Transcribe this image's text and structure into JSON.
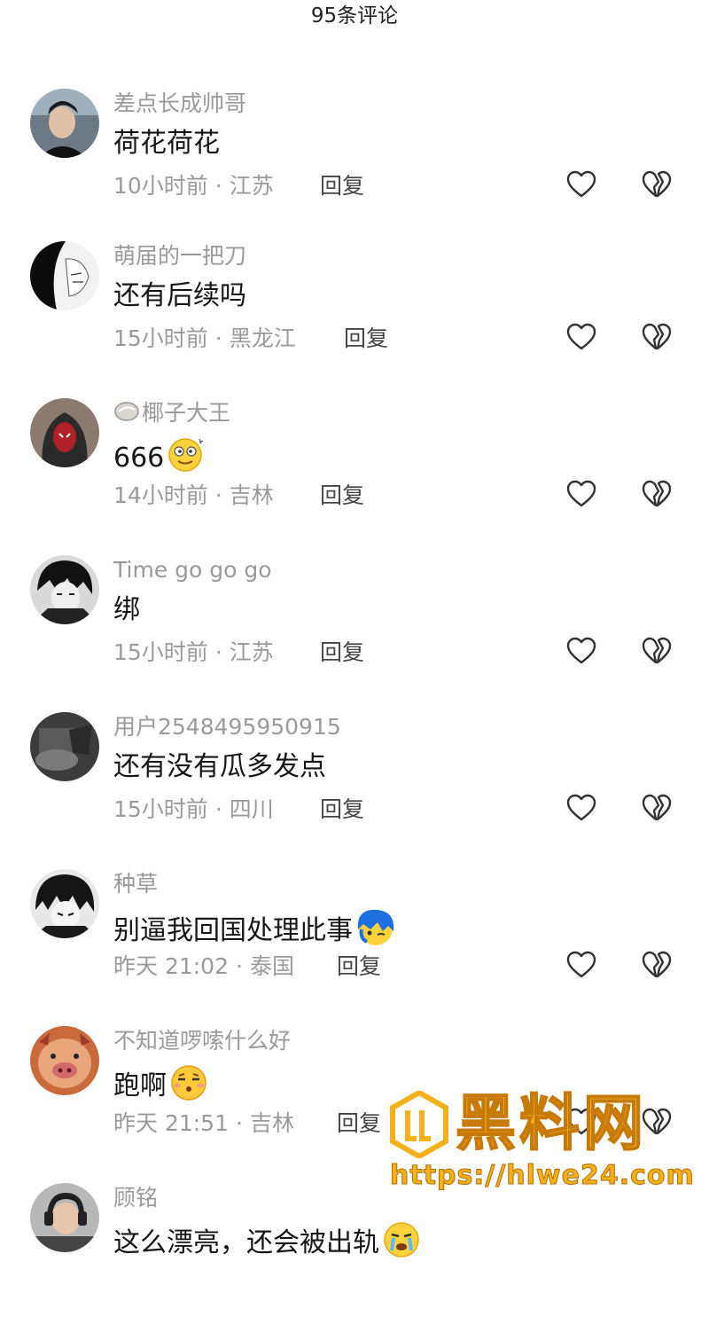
{
  "header": {
    "title": "95条评论"
  },
  "comments": [
    {
      "username": "差点长成帅哥",
      "text": "荷花荷花",
      "time": "10小时前",
      "location": "江苏",
      "reply": "回复",
      "avatar": "avatar-young-man"
    },
    {
      "username": "萌届的一把刀",
      "text": "还有后续吗",
      "time": "15小时前",
      "location": "黑龙江",
      "reply": "回复",
      "avatar": "avatar-anime-sketch"
    },
    {
      "username": "椰子大王",
      "badge": "coconut-badge-icon",
      "text": "666",
      "emoji": "dizzy-face-emoji",
      "time": "14小时前",
      "location": "吉林",
      "reply": "回复",
      "avatar": "avatar-spiderman-hood"
    },
    {
      "username": "Time go go go",
      "text": "绑",
      "time": "15小时前",
      "location": "江苏",
      "reply": "回复",
      "avatar": "avatar-anime-dark"
    },
    {
      "username": "用户2548495950915",
      "text": "还有没有瓜多发点",
      "time": "15小时前",
      "location": "四川",
      "reply": "回复",
      "avatar": "avatar-dark-photo"
    },
    {
      "username": "种草",
      "text": "别逼我回国处理此事",
      "emoji": "blue-hair-emoji",
      "time": "昨天 21:02",
      "location": "泰国",
      "reply": "回复",
      "avatar": "avatar-manga-boy"
    },
    {
      "username": "不知道啰嗦什么好",
      "text": "跑啊",
      "emoji": "unamused-face-emoji",
      "time": "昨天 21:51",
      "location": "吉林",
      "reply": "回复",
      "avatar": "avatar-pig-character"
    },
    {
      "username": "顾铭",
      "text": "这么漂亮，还会被出轨",
      "emoji": "crying-face-emoji",
      "time": "",
      "location": "",
      "reply": "",
      "avatar": "avatar-headphones"
    }
  ],
  "watermark": {
    "title": "黑料网",
    "url": "https://hlwe24.com"
  },
  "colors": {
    "background": "#ffffff",
    "meta_text": "#9a9a9a",
    "watermark": "#f6b01a"
  }
}
